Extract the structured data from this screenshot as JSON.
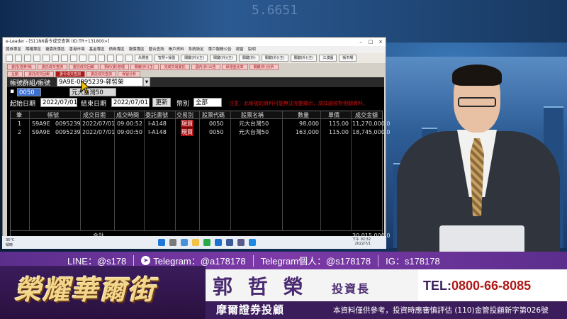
{
  "colors": {
    "accent_purple": "#7d3aa8",
    "brand_red": "#b01818",
    "gold": "#f2d68a"
  },
  "background": {
    "ticker_text": "5.6651"
  },
  "window": {
    "title": "e-Leader - [S11N6委令成交查詢 (ID:TR+131800>]",
    "controls": [
      "–",
      "□",
      "×"
    ],
    "menu": [
      "證券專區",
      "期權專區",
      "複委託專區",
      "香港市場",
      "基金專區",
      "債券專區",
      "報價專區",
      "整合查詢",
      "帳戶資料",
      "系統設定",
      "專戶服務公告",
      "視窗",
      "說明"
    ],
    "toolbar": [
      "",
      "",
      "",
      "",
      "",
      "",
      "",
      "",
      "",
      "",
      "",
      "",
      "",
      "",
      "永豐金",
      "智慧+操盤",
      "關鍵(外)(主)",
      "關鍵(外)(主)",
      "關鍵(外)",
      "關鍵(外)(主)",
      "關鍵(外)(主)",
      "江波圖",
      "帳市場"
    ],
    "tabs_row1": [
      "委託(證券)帳",
      "委託成交查詢",
      "委託成交回報",
      "預約(委)管理"
    ],
    "tabs_row2": [
      "互動",
      "委託成交回報",
      "委託成交查詢",
      "保留分析"
    ],
    "tabs_row3": [
      "關鍵(外)(主)",
      "完成交易委託",
      "國內(外)公告",
      "保證金比率",
      "關鍵(外)分析"
    ],
    "active_tab": "委令成交查詢"
  },
  "query": {
    "account_group_label": "帳號群組/帳號",
    "account_value": "9A9E-0095239-郭哲榮",
    "stock_code": "0050",
    "stock_name": "元大台灣50",
    "start_label": "起始日期",
    "start_date": "2022/07/01",
    "end_label": "結束日期",
    "end_date": "2022/07/01",
    "refresh_button": "更新",
    "currency_label": "幣別",
    "currency_value": "全部",
    "warning": "注意：此帳號的資料可能無法完整顯示，請詳細核對相關資料。"
  },
  "table": {
    "columns": [
      "筆",
      "帳號",
      "",
      "成交日期",
      "成交時間",
      "委託書號",
      "交易別",
      "股票代碼",
      "股票名稱",
      "數量",
      "單價",
      "成交金額"
    ],
    "rows": [
      {
        "n": "1",
        "acct": "S9A9E",
        "acct2": "0095239",
        "date": "2022/07/01",
        "time": "09:00:52",
        "order": "I-A148",
        "side": "現買",
        "code": "0050",
        "name": "元大台灣50",
        "qty": "98,000",
        "price": "115.00",
        "amount": "11,270,000.0"
      },
      {
        "n": "2",
        "acct": "S9A9E",
        "acct2": "0095239",
        "date": "2022/07/01",
        "time": "09:00:50",
        "order": "I-A148",
        "side": "現買",
        "code": "0050",
        "name": "元大台灣50",
        "qty": "163,000",
        "price": "115.00",
        "amount": "18,745,000.0"
      }
    ],
    "total_label": "合計",
    "total_amount": "30,015,000.0"
  },
  "taskbar": {
    "weather_temp": "35°C",
    "weather_desc": "晴時",
    "time": "下午 02:32",
    "date": "2022/7/1"
  },
  "social": {
    "line": "LINE：@s178",
    "telegram": "Telegram：@a178178",
    "telegram_personal": "Telegram個人：@s178178",
    "ig": "IG：s178178"
  },
  "lower_third": {
    "logo": "榮耀華爾街",
    "name": "郭 哲 榮",
    "title": "投資長",
    "tel_label": "TEL:",
    "tel_number": "0800-66-8085",
    "company": "摩爾證券投顧",
    "disclaimer": "本資料僅供參考，投資時應審慎評估 (110)金管投顧新字第026號"
  }
}
